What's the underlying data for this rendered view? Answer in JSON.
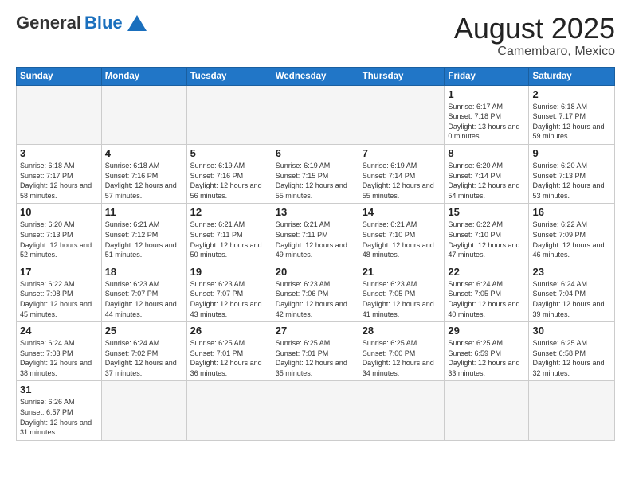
{
  "header": {
    "logo_general": "General",
    "logo_blue": "Blue",
    "month_title": "August 2025",
    "location": "Camembaro, Mexico"
  },
  "weekdays": [
    "Sunday",
    "Monday",
    "Tuesday",
    "Wednesday",
    "Thursday",
    "Friday",
    "Saturday"
  ],
  "days": {
    "d1": {
      "num": "1",
      "sunrise": "6:17 AM",
      "sunset": "7:18 PM",
      "daylight": "13 hours and 0 minutes."
    },
    "d2": {
      "num": "2",
      "sunrise": "6:18 AM",
      "sunset": "7:17 PM",
      "daylight": "12 hours and 59 minutes."
    },
    "d3": {
      "num": "3",
      "sunrise": "6:18 AM",
      "sunset": "7:17 PM",
      "daylight": "12 hours and 58 minutes."
    },
    "d4": {
      "num": "4",
      "sunrise": "6:18 AM",
      "sunset": "7:16 PM",
      "daylight": "12 hours and 57 minutes."
    },
    "d5": {
      "num": "5",
      "sunrise": "6:19 AM",
      "sunset": "7:16 PM",
      "daylight": "12 hours and 56 minutes."
    },
    "d6": {
      "num": "6",
      "sunrise": "6:19 AM",
      "sunset": "7:15 PM",
      "daylight": "12 hours and 55 minutes."
    },
    "d7": {
      "num": "7",
      "sunrise": "6:19 AM",
      "sunset": "7:14 PM",
      "daylight": "12 hours and 55 minutes."
    },
    "d8": {
      "num": "8",
      "sunrise": "6:20 AM",
      "sunset": "7:14 PM",
      "daylight": "12 hours and 54 minutes."
    },
    "d9": {
      "num": "9",
      "sunrise": "6:20 AM",
      "sunset": "7:13 PM",
      "daylight": "12 hours and 53 minutes."
    },
    "d10": {
      "num": "10",
      "sunrise": "6:20 AM",
      "sunset": "7:13 PM",
      "daylight": "12 hours and 52 minutes."
    },
    "d11": {
      "num": "11",
      "sunrise": "6:21 AM",
      "sunset": "7:12 PM",
      "daylight": "12 hours and 51 minutes."
    },
    "d12": {
      "num": "12",
      "sunrise": "6:21 AM",
      "sunset": "7:11 PM",
      "daylight": "12 hours and 50 minutes."
    },
    "d13": {
      "num": "13",
      "sunrise": "6:21 AM",
      "sunset": "7:11 PM",
      "daylight": "12 hours and 49 minutes."
    },
    "d14": {
      "num": "14",
      "sunrise": "6:21 AM",
      "sunset": "7:10 PM",
      "daylight": "12 hours and 48 minutes."
    },
    "d15": {
      "num": "15",
      "sunrise": "6:22 AM",
      "sunset": "7:10 PM",
      "daylight": "12 hours and 47 minutes."
    },
    "d16": {
      "num": "16",
      "sunrise": "6:22 AM",
      "sunset": "7:09 PM",
      "daylight": "12 hours and 46 minutes."
    },
    "d17": {
      "num": "17",
      "sunrise": "6:22 AM",
      "sunset": "7:08 PM",
      "daylight": "12 hours and 45 minutes."
    },
    "d18": {
      "num": "18",
      "sunrise": "6:23 AM",
      "sunset": "7:07 PM",
      "daylight": "12 hours and 44 minutes."
    },
    "d19": {
      "num": "19",
      "sunrise": "6:23 AM",
      "sunset": "7:07 PM",
      "daylight": "12 hours and 43 minutes."
    },
    "d20": {
      "num": "20",
      "sunrise": "6:23 AM",
      "sunset": "7:06 PM",
      "daylight": "12 hours and 42 minutes."
    },
    "d21": {
      "num": "21",
      "sunrise": "6:23 AM",
      "sunset": "7:05 PM",
      "daylight": "12 hours and 41 minutes."
    },
    "d22": {
      "num": "22",
      "sunrise": "6:24 AM",
      "sunset": "7:05 PM",
      "daylight": "12 hours and 40 minutes."
    },
    "d23": {
      "num": "23",
      "sunrise": "6:24 AM",
      "sunset": "7:04 PM",
      "daylight": "12 hours and 39 minutes."
    },
    "d24": {
      "num": "24",
      "sunrise": "6:24 AM",
      "sunset": "7:03 PM",
      "daylight": "12 hours and 38 minutes."
    },
    "d25": {
      "num": "25",
      "sunrise": "6:24 AM",
      "sunset": "7:02 PM",
      "daylight": "12 hours and 37 minutes."
    },
    "d26": {
      "num": "26",
      "sunrise": "6:25 AM",
      "sunset": "7:01 PM",
      "daylight": "12 hours and 36 minutes."
    },
    "d27": {
      "num": "27",
      "sunrise": "6:25 AM",
      "sunset": "7:01 PM",
      "daylight": "12 hours and 35 minutes."
    },
    "d28": {
      "num": "28",
      "sunrise": "6:25 AM",
      "sunset": "7:00 PM",
      "daylight": "12 hours and 34 minutes."
    },
    "d29": {
      "num": "29",
      "sunrise": "6:25 AM",
      "sunset": "6:59 PM",
      "daylight": "12 hours and 33 minutes."
    },
    "d30": {
      "num": "30",
      "sunrise": "6:25 AM",
      "sunset": "6:58 PM",
      "daylight": "12 hours and 32 minutes."
    },
    "d31": {
      "num": "31",
      "sunrise": "6:26 AM",
      "sunset": "6:57 PM",
      "daylight": "12 hours and 31 minutes."
    }
  }
}
